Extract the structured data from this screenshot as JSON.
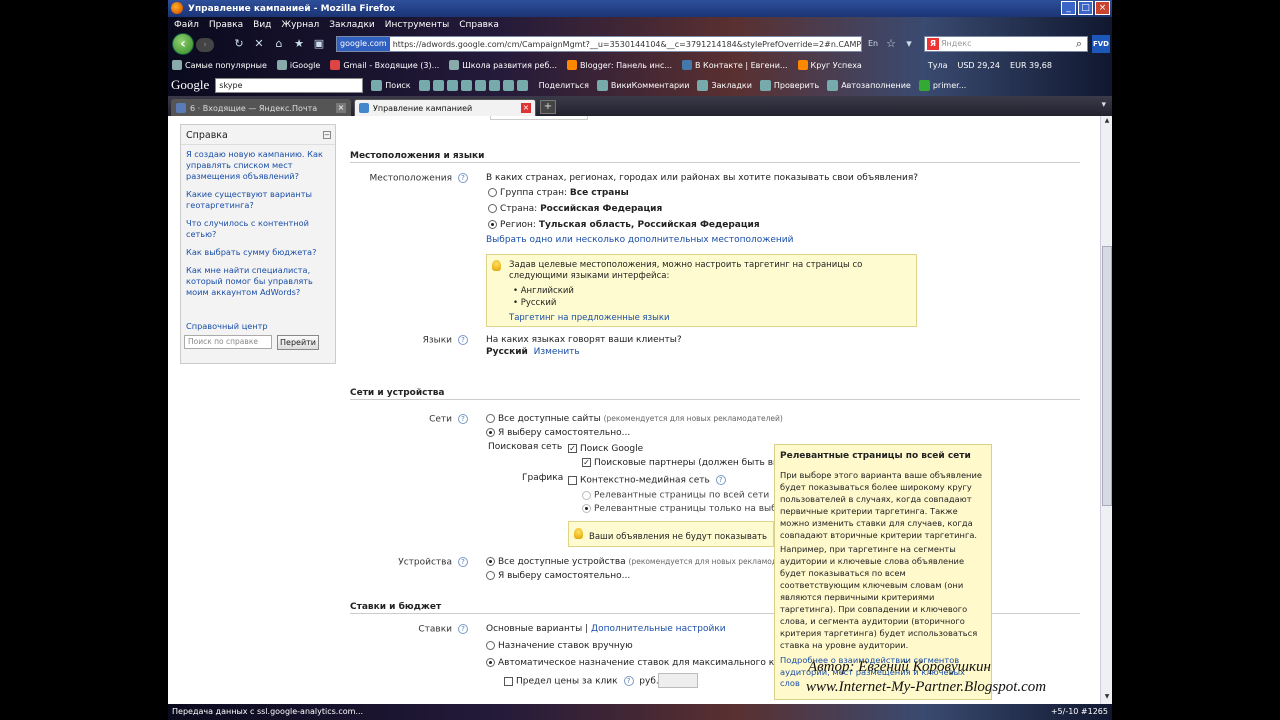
{
  "window": {
    "title": "Управление кампанией - Mozilla Firefox",
    "buttons": {
      "minimize": "_",
      "maximize": "□",
      "close": "×"
    }
  },
  "menu": [
    "Файл",
    "Правка",
    "Вид",
    "Журнал",
    "Закладки",
    "Инструменты",
    "Справка"
  ],
  "nav": {
    "site_badge": "google.com",
    "url": "https://adwords.google.com/cm/CampaignMgmt?__u=3530144104&__c=3791214184&stylePrefOverride=2#n.CAMPAIGNSETTIN",
    "lang": "En",
    "search_placeholder": "Яндекс",
    "fvd": "FVD"
  },
  "bookmarks": [
    "Самые популярные",
    "iGoogle",
    "Gmail - Входящие (3)...",
    "Школа развития реб...",
    "Blogger: Панель инс...",
    "В Контакте | Евгени...",
    "Круг Успеха",
    "Тула",
    "USD 29,24",
    "EUR 39,68"
  ],
  "toolbar2": {
    "logo": "Google",
    "query": "skype",
    "search_btn": "Поиск",
    "items": [
      "Поделиться",
      "ВикиКомментарии",
      "Закладки",
      "Проверить",
      "Автозаполнение",
      "primer..."
    ]
  },
  "tabs": [
    {
      "label": "6 · Входящие — Яндекс.Почта",
      "active": false
    },
    {
      "label": "Управление кампанией",
      "active": true
    }
  ],
  "sidebar": {
    "title": "Справка",
    "links": [
      "Я создаю новую кампанию. Как управлять списком мест размещения объявлений?",
      "Какие существуют варианты геотаргетинга?",
      "Что случилось с контентной сетью?",
      "Как выбрать сумму бюджета?",
      "Как мне найти специалиста, который помог бы управлять моим аккаунтом AdWords?"
    ],
    "help_center": "Справочный центр",
    "search_placeholder": "Поиск по справке",
    "go": "Перейти"
  },
  "locations": {
    "section": "Местоположения и языки",
    "label": "Местоположения",
    "question": "В каких странах, регионах, городах или районах вы хотите показывать свои объявления?",
    "options": [
      {
        "prefix": "Группа стран: ",
        "value": "Все страны",
        "selected": false
      },
      {
        "prefix": "Страна: ",
        "value": "Российская Федерация",
        "selected": false
      },
      {
        "prefix": "Регион: ",
        "value": "Тульская область, Российская Федерация",
        "selected": true
      }
    ],
    "more_link": "Выбрать одно или несколько дополнительных местоположений",
    "note": {
      "text": "Задав целевые местоположения, можно настроить таргетинг на страницы со следующими языками интерфейса:",
      "langs": [
        "Английский",
        "Русский"
      ],
      "link": "Таргетинг на предложенные языки"
    },
    "lang_label": "Языки",
    "lang_question": "На каких языках говорят ваши клиенты?",
    "lang_value": "Русский",
    "lang_change": "Изменить"
  },
  "networks": {
    "section": "Сети и устройства",
    "label": "Сети",
    "all": "Все доступные сайты",
    "all_note": "(рекомендуется для новых рекламодателей)",
    "custom": "Я выберу самостоятельно...",
    "search_label": "Поисковая сеть",
    "google_search": "Поиск Google",
    "partners": "Поисковые партнеры (должен быть вклю",
    "display_label": "Графика",
    "display": "Контекстно-медийная сеть",
    "relevant_all": "Релевантные страницы по всей сети",
    "relevant_some": "Релевантные страницы только на выбра",
    "warning": "Ваши объявления не будут показывать"
  },
  "devices": {
    "label": "Устройства",
    "all": "Все доступные устройства",
    "all_note": "(рекомендуется для новых рекламод",
    "custom": "Я выберу самостоятельно..."
  },
  "bids": {
    "section": "Ставки и бюджет",
    "label": "Ставки",
    "basic": "Основные варианты",
    "sep": "|",
    "advanced": "Дополнительные настройки",
    "manual": "Назначение ставок вручную",
    "auto": "Автоматическое назначение ставок для максимального колич",
    "cpc_limit": "Предел цены за клик",
    "currency": "руб."
  },
  "tooltip": {
    "title": "Релевантные страницы по всей сети",
    "p1": "При выборе этого варианта ваше объявление будет показываться более широкому кругу пользователей в случаях, когда совпадают первичные критерии таргетинга. Также можно изменить ставки для случаев, когда совпадают вторичные критерии таргетинга.",
    "p2": "Например, при таргетинге на сегменты аудитории и ключевые слова объявление будет показываться по всем соответствующим ключевым словам (они являются первичными критериями таргетинга). При совпадении и ключевого слова, и сегмента аудитории (вторичного критерия таргетинга) будет использоваться ставка на уровне аудитории.",
    "more": "Подробнее о взаимодействии сегментов аудитории, мест размещения и ключевых слов"
  },
  "watermark": {
    "author": "Автор: Евгений Коровушкин",
    "site": "www.Internet-My-Partner.Blogspot.com"
  },
  "status": {
    "text": "Передача данных с ssl.google-analytics.com...",
    "right": "+5/-10   #1265"
  }
}
